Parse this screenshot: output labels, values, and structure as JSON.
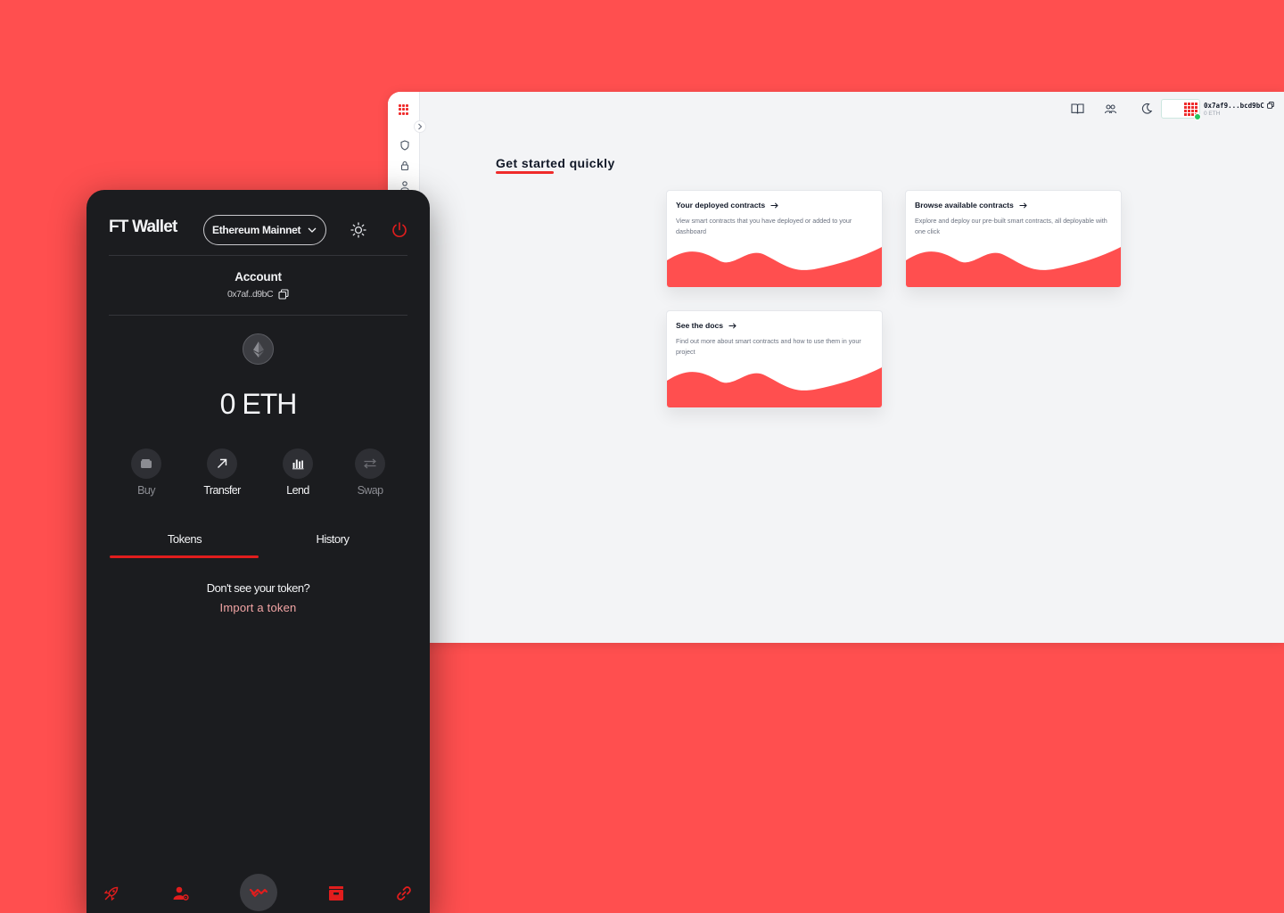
{
  "dashboard": {
    "rail": {
      "logo_icon": "dotted-logo-icon",
      "expand_icon": "chevron-right-icon",
      "items": [
        "shield-icon",
        "lock-icon",
        "user-icon"
      ]
    },
    "topbar": {
      "icons": [
        "book-icon",
        "community-icon",
        "moon-icon"
      ],
      "account_address": "0x7af9...bcd9bC",
      "account_balance": "0 ETH"
    },
    "title": "Get started quickly",
    "cards": [
      {
        "title": "Your deployed contracts",
        "description": "View smart contracts that you have deployed or added to your dashboard"
      },
      {
        "title": "Browse available contracts",
        "description": "Explore and deploy our pre-built smart contracts, all deployable with one click"
      },
      {
        "title": "See the docs",
        "description": "Find out more about smart contracts and how to use them in your project"
      }
    ],
    "accent_color": "#ef2b2b"
  },
  "wallet": {
    "brand": "FT Wallet",
    "network": "Ethereum Mainnet",
    "account_label": "Account",
    "account_address": "0x7af..d9bC",
    "balance": "0 ETH",
    "actions": [
      {
        "label": "Buy",
        "icon": "wallet-icon",
        "enabled": false
      },
      {
        "label": "Transfer",
        "icon": "arrow-up-right-icon",
        "enabled": true
      },
      {
        "label": "Lend",
        "icon": "bar-chart-icon",
        "enabled": true
      },
      {
        "label": "Swap",
        "icon": "swap-arrows-icon",
        "enabled": false
      }
    ],
    "tabs": [
      {
        "label": "Tokens",
        "active": true
      },
      {
        "label": "History",
        "active": false
      }
    ],
    "empty_hint": "Don't see your token?",
    "import_link": "Import a token",
    "bottom_nav": [
      "rocket-icon",
      "users-settings-icon",
      "waves-icon",
      "inbox-icon",
      "link-icon"
    ],
    "accent_color": "#e11d1d",
    "panel_color": "#1b1c1f"
  }
}
